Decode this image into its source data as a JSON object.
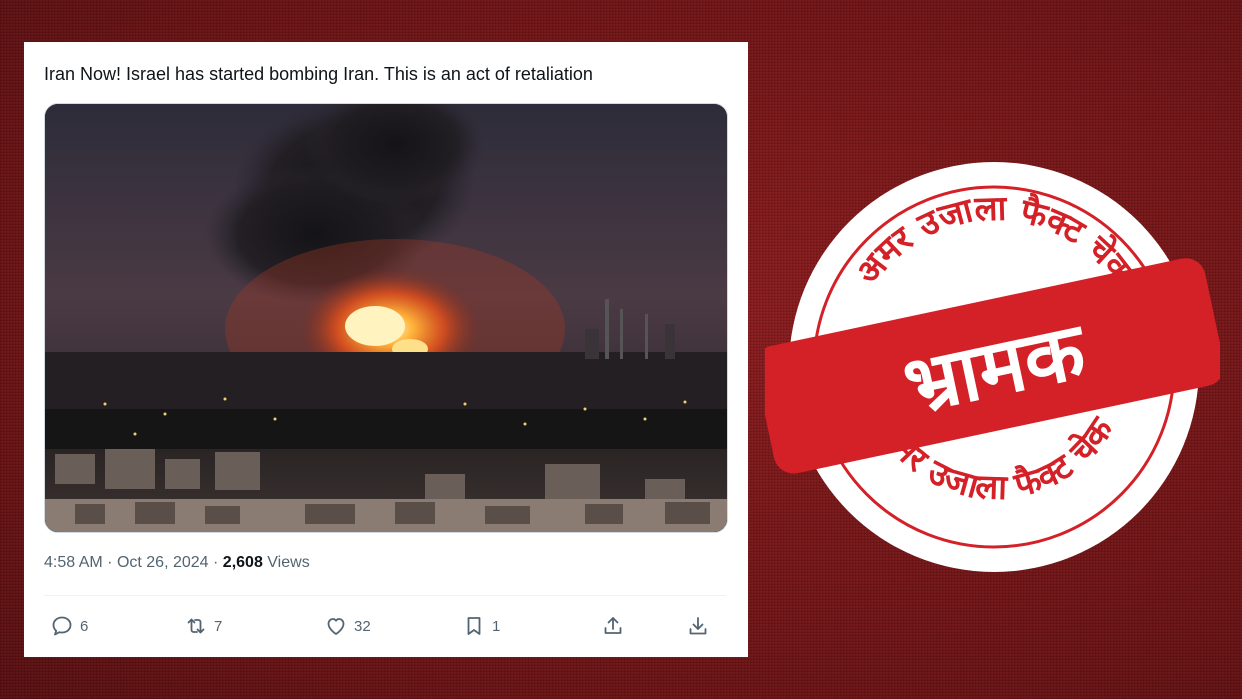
{
  "tweet": {
    "text": "Iran Now! Israel has started bombing Iran. This is an act of retaliation",
    "time": "4:58 AM",
    "date": "Oct 26, 2024",
    "views_count": "2,608",
    "views_label": "Views",
    "image_alt": "Fire and smoke rising from industrial area at night",
    "actions": {
      "reply_count": "6",
      "retweet_count": "7",
      "like_count": "32",
      "bookmark_count": "1"
    }
  },
  "stamp": {
    "top_text": "अमर उजाला फैक्ट चेक",
    "bottom_text": "अमर उजाला फैक्ट चेक",
    "verdict": "भ्रामक",
    "color": "#d42027"
  },
  "colors": {
    "background": "#7a1416",
    "card": "#ffffff",
    "text_primary": "#0f1419",
    "text_secondary": "#536471"
  }
}
